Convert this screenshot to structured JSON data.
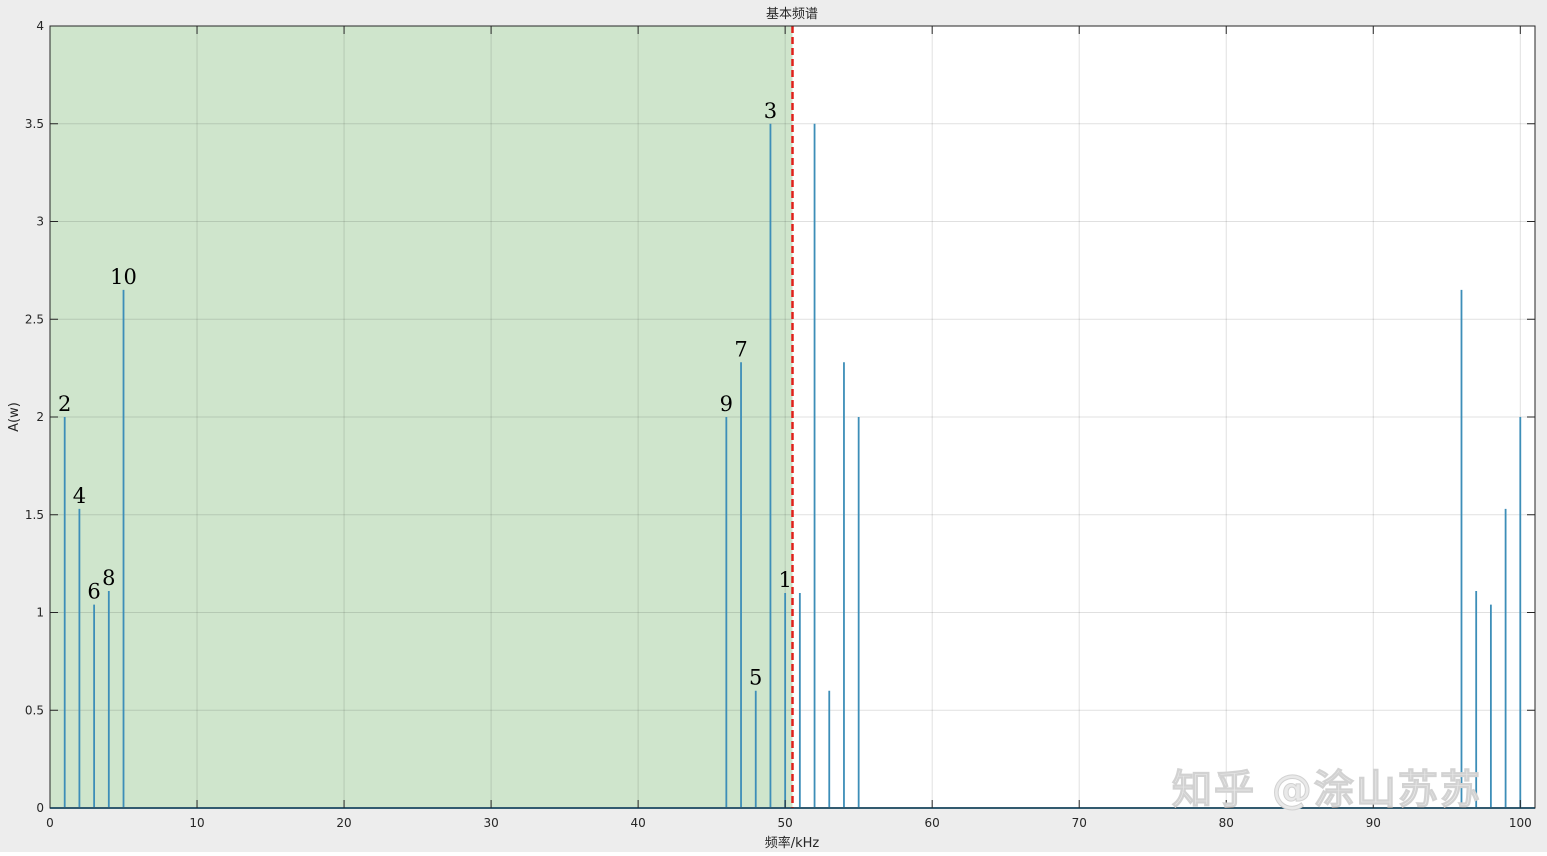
{
  "chart_data": {
    "type": "bar",
    "title": "基本频谱",
    "xlabel": "频率/kHz",
    "ylabel": "A(w)",
    "xlim": [
      0,
      101
    ],
    "ylim": [
      0,
      4
    ],
    "xticks": [
      "0",
      "10",
      "20",
      "30",
      "40",
      "50",
      "60",
      "70",
      "80",
      "90",
      "100"
    ],
    "yticks": [
      "0",
      "0.5",
      "1",
      "1.5",
      "2",
      "2.5",
      "3",
      "3.5",
      "4"
    ],
    "grid": true,
    "shaded_region": {
      "x_from": 0,
      "x_to": 50.5,
      "color": "#cfe5cc"
    },
    "reference_line": {
      "x": 50.5,
      "color": "#e0201b",
      "style": "dashed"
    },
    "series_color": "#3d8eb8",
    "stems": [
      {
        "x": 1,
        "y": 2.0,
        "label": "2"
      },
      {
        "x": 2,
        "y": 1.53,
        "label": "4"
      },
      {
        "x": 3,
        "y": 1.04,
        "label": "6"
      },
      {
        "x": 4,
        "y": 1.11,
        "label": "8"
      },
      {
        "x": 5,
        "y": 2.65,
        "label": "10"
      },
      {
        "x": 46,
        "y": 2.0,
        "label": "9"
      },
      {
        "x": 47,
        "y": 2.28,
        "label": "7"
      },
      {
        "x": 48,
        "y": 0.6,
        "label": "5"
      },
      {
        "x": 49,
        "y": 3.5,
        "label": "3"
      },
      {
        "x": 50,
        "y": 1.1,
        "label": "1"
      },
      {
        "x": 51,
        "y": 1.1,
        "label": ""
      },
      {
        "x": 52,
        "y": 3.5,
        "label": ""
      },
      {
        "x": 53,
        "y": 0.6,
        "label": ""
      },
      {
        "x": 54,
        "y": 2.28,
        "label": ""
      },
      {
        "x": 55,
        "y": 2.0,
        "label": ""
      },
      {
        "x": 96,
        "y": 2.65,
        "label": ""
      },
      {
        "x": 97,
        "y": 1.11,
        "label": ""
      },
      {
        "x": 98,
        "y": 1.04,
        "label": ""
      },
      {
        "x": 99,
        "y": 1.53,
        "label": ""
      },
      {
        "x": 100,
        "y": 2.0,
        "label": ""
      }
    ]
  },
  "watermark": "知乎 @涂山苏苏"
}
